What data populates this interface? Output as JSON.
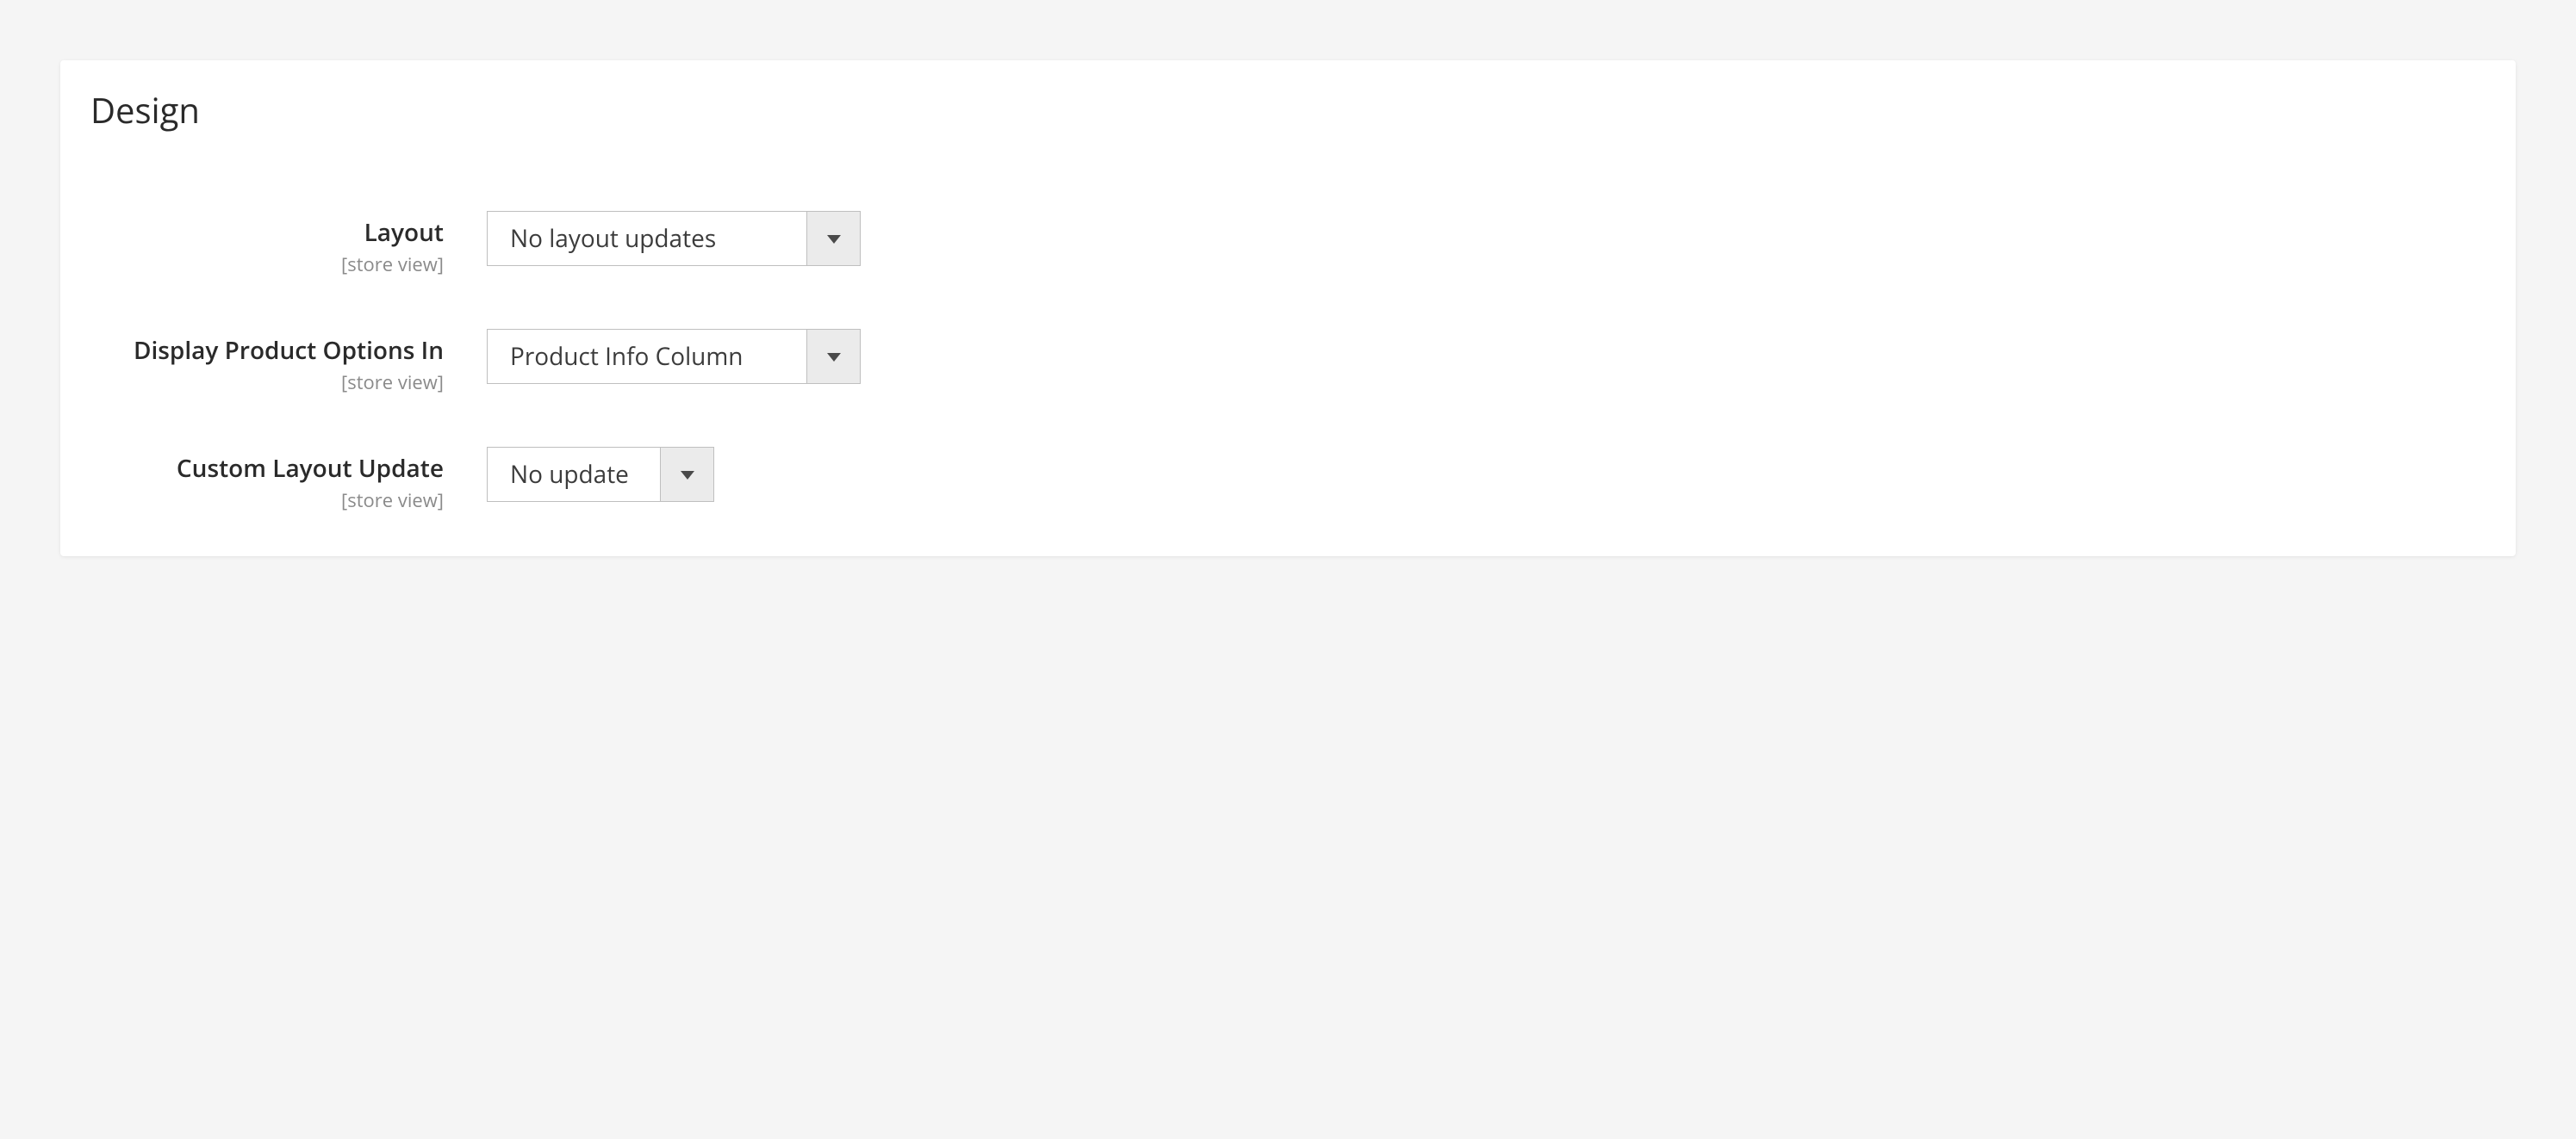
{
  "panel": {
    "title": "Design"
  },
  "fields": {
    "layout": {
      "label": "Layout",
      "scope": "[store view]",
      "value": "No layout updates"
    },
    "display_options": {
      "label": "Display Product Options In",
      "scope": "[store view]",
      "value": "Product Info Column"
    },
    "custom_layout": {
      "label": "Custom Layout Update",
      "scope": "[store view]",
      "value": "No update"
    }
  }
}
